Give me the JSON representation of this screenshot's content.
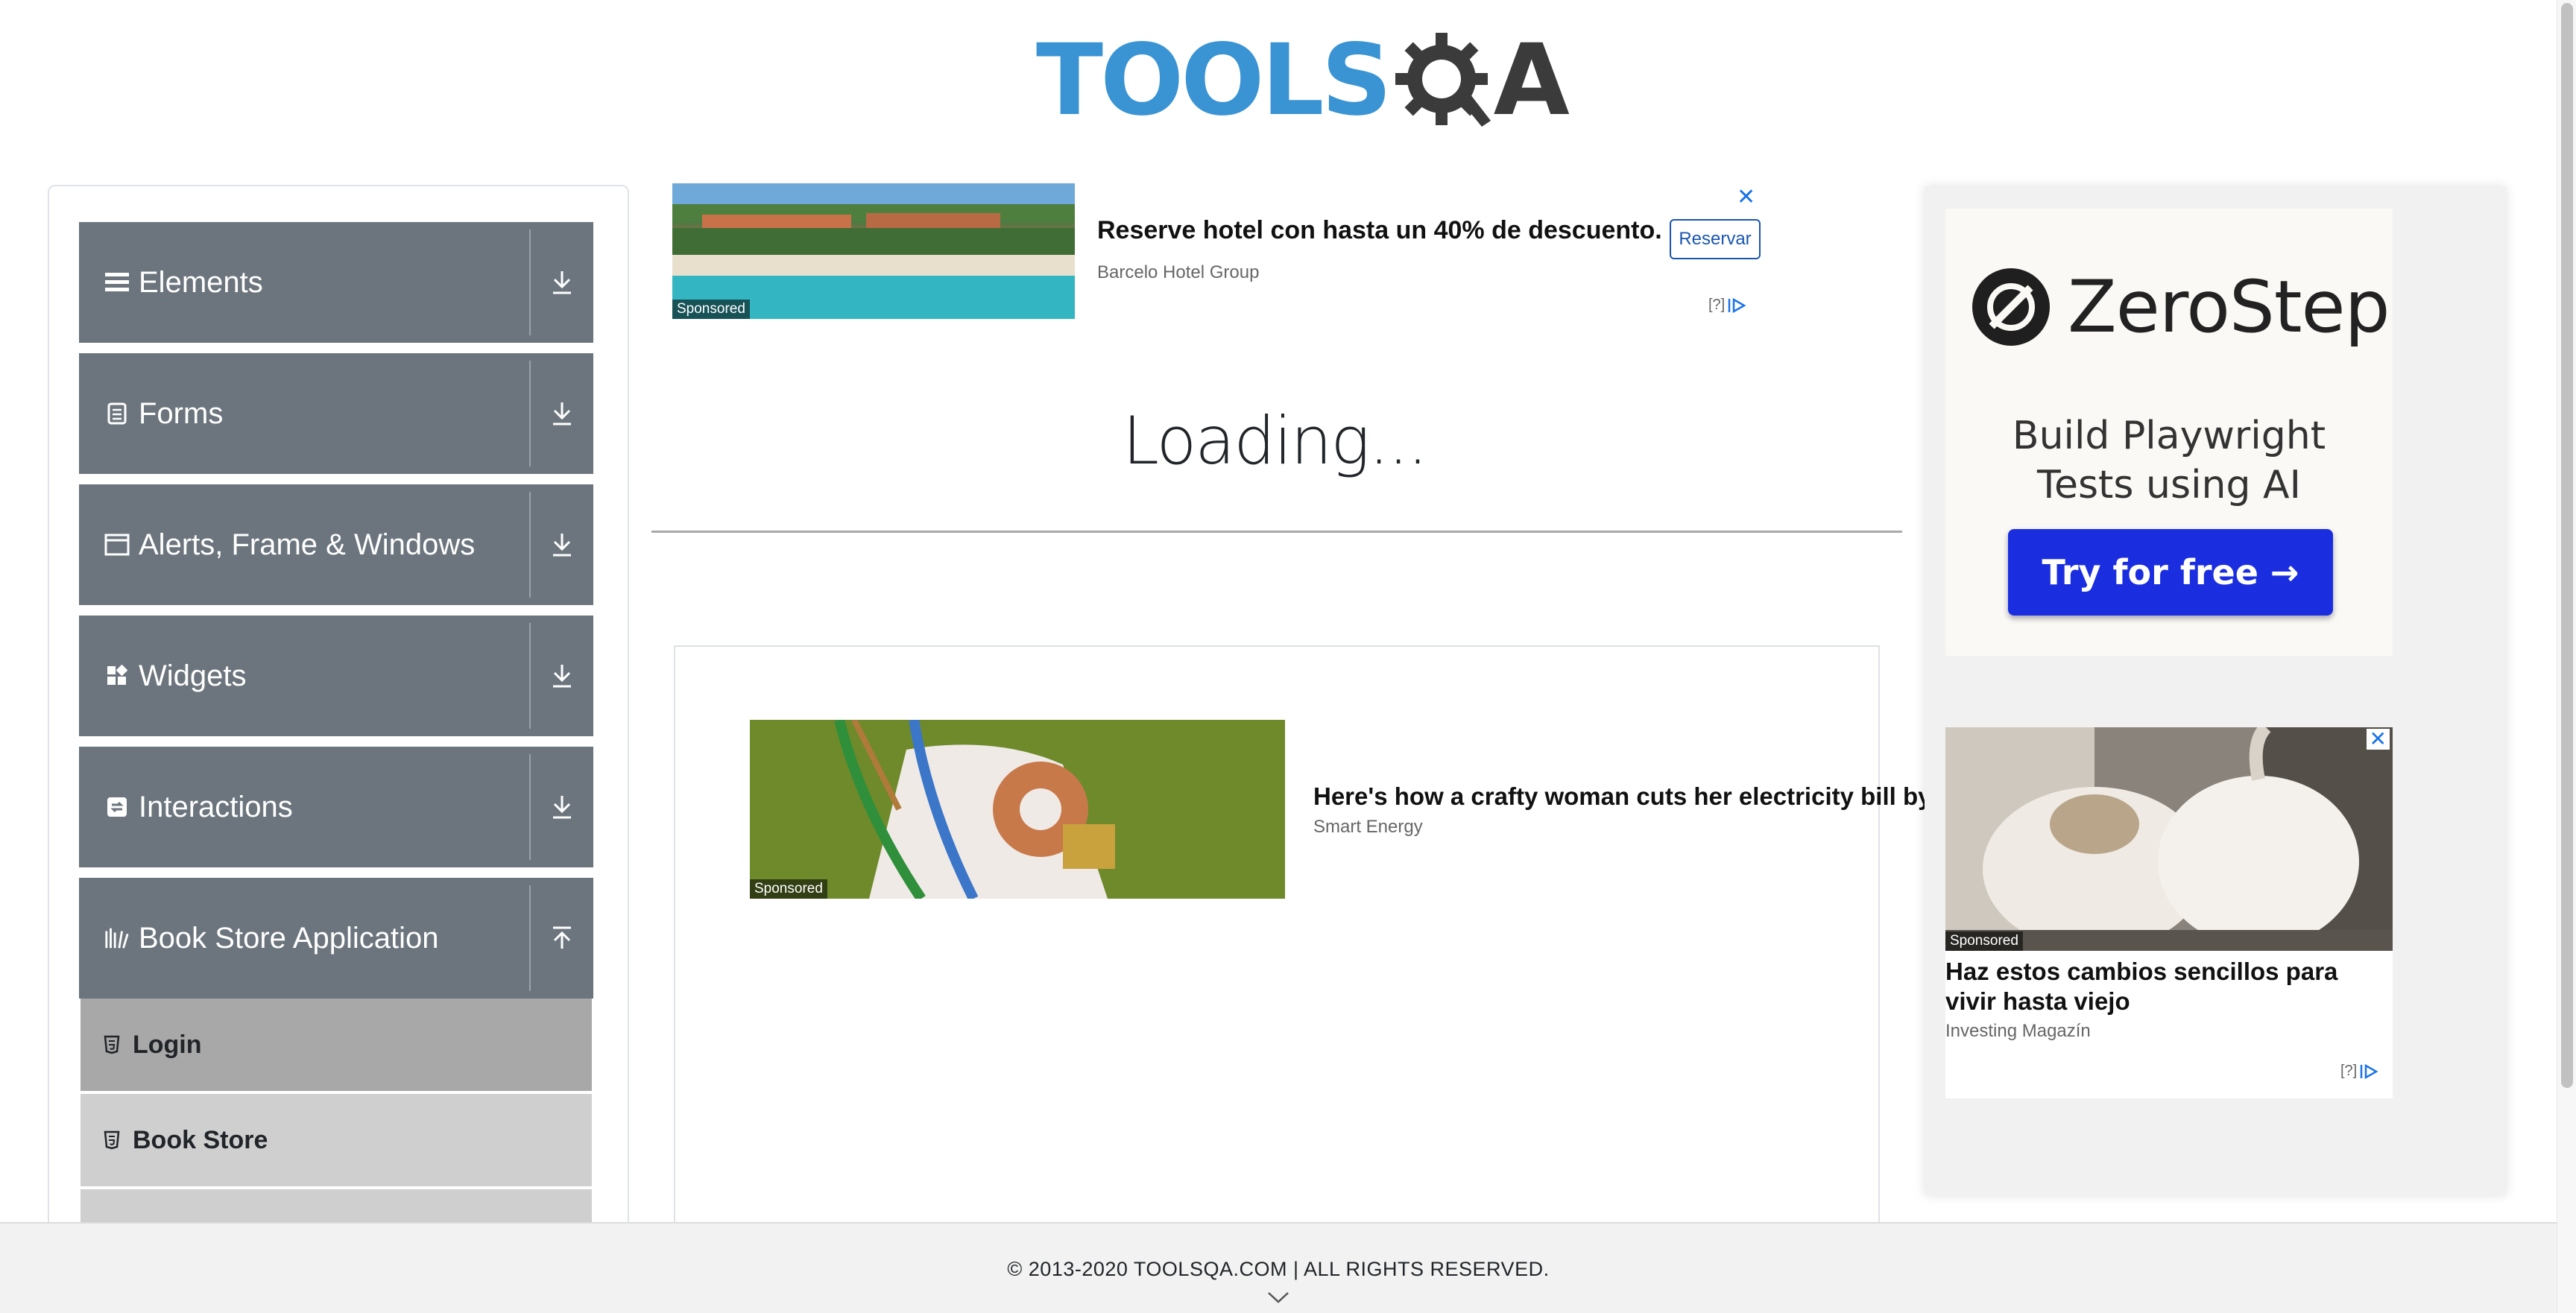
{
  "brand": {
    "logo_text": "TOOLS",
    "logo_q": "Q",
    "logo_a": "A",
    "colors": {
      "logo_blue": "#3a94d4",
      "logo_dark": "#3b3b3b",
      "sidebar_group": "#6c757d",
      "sub_active": "#a8a8a8",
      "sub_inactive": "#cfcfcf"
    }
  },
  "sidebar": {
    "groups": [
      {
        "label": "Elements",
        "icon": "hamburger-icon",
        "arrow": "download-arrow-icon"
      },
      {
        "label": "Forms",
        "icon": "form-icon",
        "arrow": "download-arrow-icon"
      },
      {
        "label": "Alerts, Frame & Windows",
        "icon": "window-icon",
        "arrow": "download-arrow-icon"
      },
      {
        "label": "Widgets",
        "icon": "widgets-icon",
        "arrow": "download-arrow-icon"
      },
      {
        "label": "Interactions",
        "icon": "interactions-icon",
        "arrow": "download-arrow-icon"
      },
      {
        "label": "Book Store Application",
        "icon": "books-icon",
        "arrow": "upload-arrow-icon"
      }
    ],
    "book_store_items": [
      {
        "label": "Login",
        "icon": "html5-icon",
        "active": true
      },
      {
        "label": "Book Store",
        "icon": "html5-icon",
        "active": false
      },
      {
        "label": "",
        "icon": "html5-icon",
        "active": false
      }
    ]
  },
  "ads": {
    "top": {
      "title": "Reserve hotel con hasta un 40% de descuento.",
      "source": "Barcelo Hotel Group",
      "button": "Reservar",
      "sponsored": "Sponsored",
      "choice": "[?]",
      "close": "✕"
    },
    "middle": {
      "title": "Here's how a crafty woman cuts her electricity bill by u",
      "source": "Smart Energy",
      "sponsored": "Sponsored"
    },
    "right_zerostep": {
      "name": "ZeroStep",
      "tagline_line1": "Build Playwright",
      "tagline_line2": "Tests using AI",
      "button": "Try for free →"
    },
    "right_garlic": {
      "title": "Haz estos cambios sencillos para vivir hasta viejo",
      "source": "Investing Magazín",
      "sponsored": "Sponsored",
      "choice": "[?]",
      "close": "✕"
    }
  },
  "main": {
    "loading_text": "Loading..."
  },
  "footer": {
    "text": "© 2013-2020 TOOLSQA.COM | ALL RIGHTS RESERVED."
  }
}
